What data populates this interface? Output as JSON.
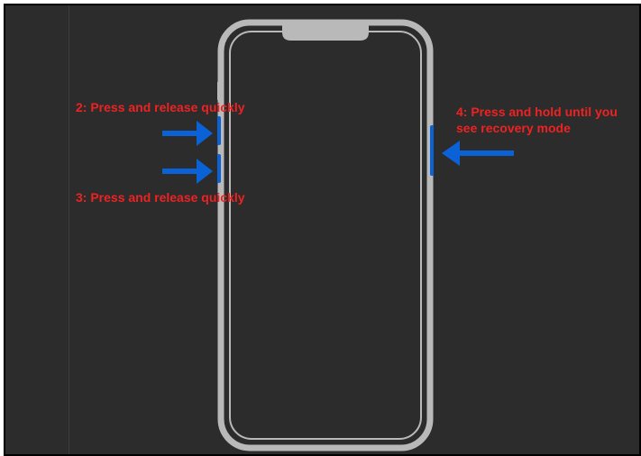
{
  "labels": {
    "step2": "2: Press and release quickly",
    "step3": "3: Press and release quickly",
    "step4": "4: Press and hold until you\nsee recovery mode"
  },
  "colors": {
    "background": "#2c2c2c",
    "phone_outline": "#b9b9b9",
    "arrow": "#0b62d6",
    "text": "#e22222"
  },
  "diagram": {
    "device": "iphone-notch",
    "buttons": {
      "volume_up": {
        "side": "left",
        "step": 2,
        "action": "Press and release quickly"
      },
      "volume_down": {
        "side": "left",
        "step": 3,
        "action": "Press and release quickly"
      },
      "side_button": {
        "side": "right",
        "step": 4,
        "action": "Press and hold until you see recovery mode"
      }
    }
  }
}
